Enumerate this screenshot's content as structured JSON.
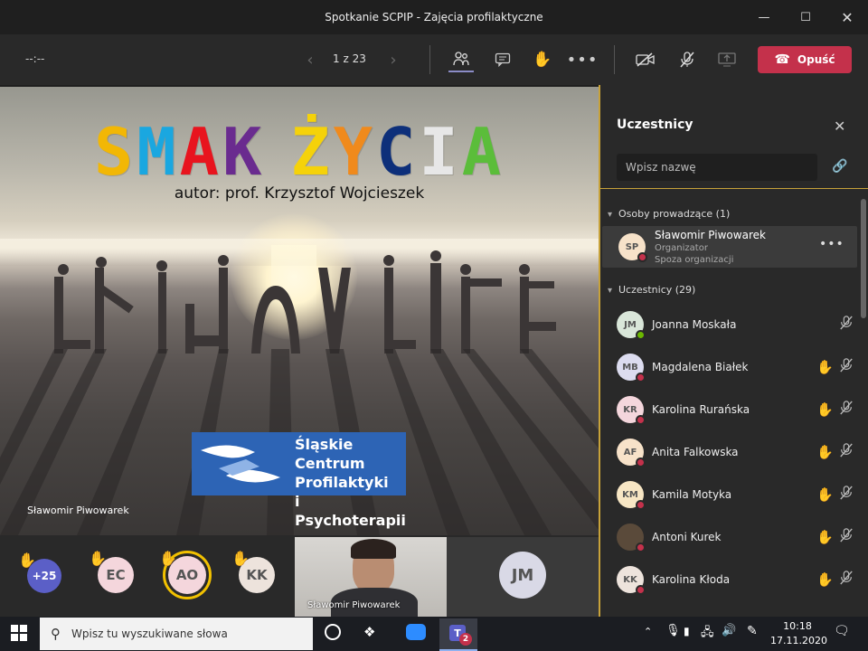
{
  "window": {
    "title": "Spotkanie SCPIP - Zajęcia profilaktyczne",
    "minimize_icon": "minimize-icon",
    "maximize_icon": "maximize-icon",
    "close_icon": "close-icon"
  },
  "toolbar": {
    "timer": "--:--",
    "page_counter": "1 z 23",
    "leave_label": "Opuść"
  },
  "slide": {
    "title_letters": [
      {
        "ch": "S",
        "color": "#f2b705"
      },
      {
        "ch": "M",
        "color": "#1aa7e0"
      },
      {
        "ch": "A",
        "color": "#e8141e"
      },
      {
        "ch": "K",
        "color": "#6a2b8f"
      },
      {
        "ch": " ",
        "color": "#000000"
      },
      {
        "ch": "Ż",
        "color": "#f5d20a"
      },
      {
        "ch": "Y",
        "color": "#f08a1c"
      },
      {
        "ch": "C",
        "color": "#0d2f7a"
      },
      {
        "ch": "I",
        "color": "#e7e7e7"
      },
      {
        "ch": "A",
        "color": "#5bbd3a"
      }
    ],
    "subtitle": "autor: prof. Krzysztof Wojcieszek",
    "logo_lines": [
      "Śląskie Centrum",
      "Profilaktyki",
      "i Psychoterapii"
    ],
    "presenter": "Sławomir Piwowarek"
  },
  "strip": {
    "overflow": "+25",
    "avatars": [
      {
        "initials": "EC",
        "hand": true
      },
      {
        "initials": "AO",
        "hand": true
      },
      {
        "initials": "KK",
        "hand": true
      }
    ],
    "video_name": "Sławomir Piwowarek",
    "jm": "JM"
  },
  "panel": {
    "title": "Uczestnicy",
    "search_placeholder": "Wpisz nazwę",
    "presenters_header": "Osoby prowadzące (1)",
    "presenter": {
      "initials": "SP",
      "name": "Sławomir Piwowarek",
      "role": "Organizator",
      "org": "Spoza organizacji"
    },
    "attendees_header": "Uczestnicy (29)",
    "attendees": [
      {
        "initials": "JM",
        "name": "Joanna Moskała",
        "hand": false,
        "status": "#6bb700"
      },
      {
        "initials": "MB",
        "name": "Magdalena Białek",
        "hand": true,
        "status": "#c4314b"
      },
      {
        "initials": "KR",
        "name": "Karolina Rurańska",
        "hand": true,
        "status": "#c4314b"
      },
      {
        "initials": "AF",
        "name": "Anita Falkowska",
        "hand": true,
        "status": "#c4314b"
      },
      {
        "initials": "KM",
        "name": "Kamila Motyka",
        "hand": true,
        "status": "#c4314b"
      },
      {
        "initials": "",
        "name": "Antoni Kurek",
        "hand": true,
        "status": "#c4314b"
      },
      {
        "initials": "KK",
        "name": "Karolina Kłoda",
        "hand": true,
        "status": "#c4314b"
      }
    ]
  },
  "taskbar": {
    "search_placeholder": "Wpisz tu wyszukiwane słowa",
    "time": "10:18",
    "date": "17.11.2020",
    "teams_badge": "2"
  }
}
